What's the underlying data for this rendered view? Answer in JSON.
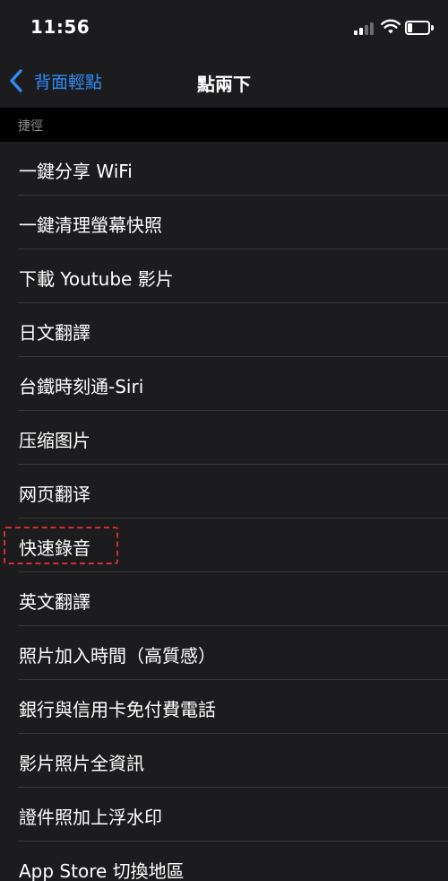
{
  "status_bar": {
    "time": "11:56",
    "icons": [
      "signal-icon",
      "wifi-icon",
      "battery-icon"
    ]
  },
  "nav": {
    "back_label": "背面輕點",
    "title": "點兩下",
    "accent_color": "#2f8bf6"
  },
  "section": {
    "header": "捷徑"
  },
  "items": [
    {
      "label": "一鍵分享 WiFi"
    },
    {
      "label": "一鍵清理螢幕快照"
    },
    {
      "label": "下載 Youtube 影片"
    },
    {
      "label": "日文翻譯"
    },
    {
      "label": "台鐵時刻通-Siri"
    },
    {
      "label": "压缩图片"
    },
    {
      "label": "网页翻译"
    },
    {
      "label": "快速錄音",
      "highlighted": true,
      "highlight_color": "#d62f2f"
    },
    {
      "label": "英文翻譯"
    },
    {
      "label": "照片加入時間（高質感）"
    },
    {
      "label": "銀行與信用卡免付費電話"
    },
    {
      "label": "影片照片全資訊"
    },
    {
      "label": "證件照加上浮水印"
    },
    {
      "label": "App Store 切換地區"
    }
  ]
}
